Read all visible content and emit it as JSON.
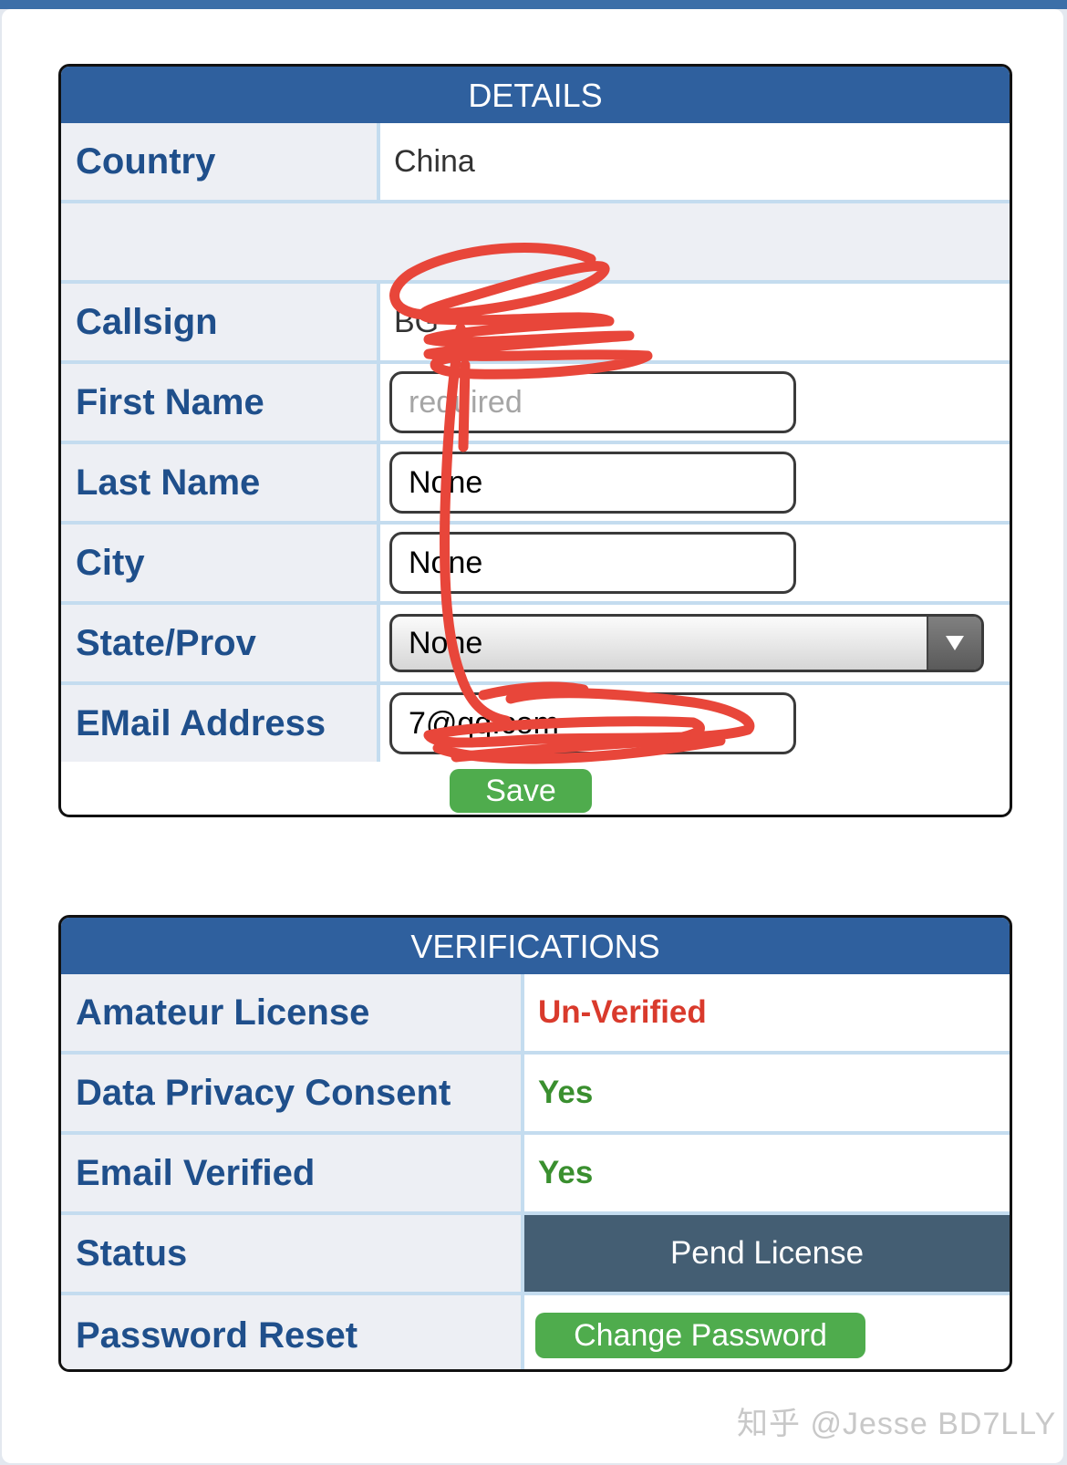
{
  "details": {
    "title": "DETAILS",
    "country_label": "Country",
    "country_value": "China",
    "callsign_label": "Callsign",
    "callsign_value": "BG",
    "first_name_label": "First Name",
    "first_name_value": "",
    "first_name_placeholder": "required",
    "last_name_label": "Last Name",
    "last_name_value": "None",
    "city_label": "City",
    "city_value": "None",
    "state_label": "State/Prov",
    "state_value": "None",
    "email_label": "EMail Address",
    "email_value": "7@qq.com",
    "save_label": "Save"
  },
  "verifications": {
    "title": "VERIFICATIONS",
    "amateur_license_label": "Amateur License",
    "amateur_license_value": "Un-Verified",
    "privacy_label": "Data Privacy Consent",
    "privacy_value": "Yes",
    "email_verified_label": "Email Verified",
    "email_verified_value": "Yes",
    "status_label": "Status",
    "status_value": "Pend License",
    "password_reset_label": "Password Reset",
    "change_password_label": "Change Password"
  },
  "watermark": "知乎 @Jesse BD7LLY",
  "colors": {
    "header_blue": "#2f609e",
    "label_text": "#1f4f8b",
    "unverified_red": "#d93a2c",
    "yes_green": "#3a8f2f",
    "button_green": "#4fac4d",
    "status_bg": "#445e73",
    "redaction_scribble": "#e8463a"
  },
  "icons": {
    "select_arrow": "triangle-down-icon"
  }
}
